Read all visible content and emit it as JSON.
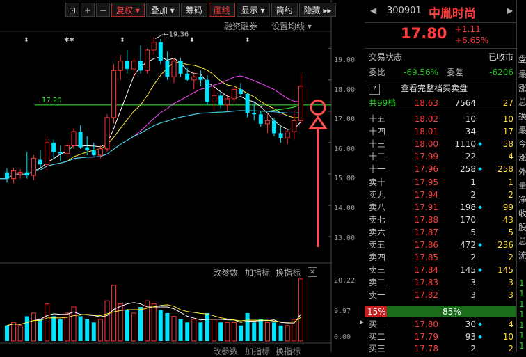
{
  "toolbar": {
    "items": [
      {
        "label": "复权 ▾",
        "active": true
      },
      {
        "label": "叠加 ▾",
        "active": false
      },
      {
        "label": "筹码",
        "active": false
      },
      {
        "label": "画线",
        "active": true
      },
      {
        "label": "显示 ▾",
        "active": false
      },
      {
        "label": "简约",
        "active": false
      },
      {
        "label": "隐藏 ▸▸",
        "active": false
      }
    ],
    "sub_financing": "融资融券",
    "sub_ma_setting": "设置均线 ▾"
  },
  "chart": {
    "price_axis": [
      "19.00",
      "18.00",
      "17.00",
      "16.00",
      "15.00",
      "14.00",
      "13.00"
    ],
    "vol_axis": [
      "20.22",
      "9.97",
      "0.00"
    ],
    "annot_high": "19.36",
    "annot_line": "17.20",
    "ind_buttons": [
      "改参数",
      "加指标",
      "换指标"
    ],
    "ind_close": "✕",
    "bot_buttons": [
      "改参数",
      "加指标",
      "换指标"
    ],
    "colors": {
      "up": "#ff3333",
      "down": "#00e5ff",
      "ma5": "#ffffff",
      "ma10": "#ffee33",
      "ma20": "#ff44ff",
      "ma60": "#33ff33",
      "ma120": "#44ccff",
      "annotation": "#ff4f4f"
    }
  },
  "chart_data": {
    "type": "candlestick",
    "candles": [
      {
        "o": 15.05,
        "h": 15.18,
        "l": 14.72,
        "c": 14.85,
        "v": 5
      },
      {
        "o": 14.85,
        "h": 15.2,
        "l": 14.7,
        "c": 15.1,
        "v": 6
      },
      {
        "o": 15.0,
        "h": 15.15,
        "l": 14.85,
        "c": 15.05,
        "v": 5
      },
      {
        "o": 15.05,
        "h": 15.7,
        "l": 14.85,
        "c": 14.95,
        "v": 8
      },
      {
        "o": 14.95,
        "h": 15.6,
        "l": 14.8,
        "c": 15.5,
        "v": 9
      },
      {
        "o": 15.45,
        "h": 15.75,
        "l": 15.2,
        "c": 15.3,
        "v": 7
      },
      {
        "o": 15.3,
        "h": 16.2,
        "l": 15.1,
        "c": 16.0,
        "v": 12
      },
      {
        "o": 16.0,
        "h": 16.1,
        "l": 15.5,
        "c": 15.7,
        "v": 8
      },
      {
        "o": 15.7,
        "h": 15.9,
        "l": 15.4,
        "c": 15.65,
        "v": 7
      },
      {
        "o": 15.65,
        "h": 16.0,
        "l": 15.5,
        "c": 15.9,
        "v": 9
      },
      {
        "o": 15.9,
        "h": 16.45,
        "l": 15.8,
        "c": 16.35,
        "v": 11
      },
      {
        "o": 16.35,
        "h": 16.55,
        "l": 15.8,
        "c": 15.85,
        "v": 8
      },
      {
        "o": 15.85,
        "h": 16.2,
        "l": 15.6,
        "c": 15.75,
        "v": 7
      },
      {
        "o": 15.75,
        "h": 16.0,
        "l": 15.55,
        "c": 15.6,
        "v": 6
      },
      {
        "o": 15.6,
        "h": 15.9,
        "l": 15.5,
        "c": 15.8,
        "v": 7
      },
      {
        "o": 15.8,
        "h": 16.9,
        "l": 15.7,
        "c": 16.8,
        "v": 13
      },
      {
        "o": 16.8,
        "h": 18.5,
        "l": 16.6,
        "c": 18.3,
        "v": 18
      },
      {
        "o": 18.3,
        "h": 18.8,
        "l": 18.0,
        "c": 18.6,
        "v": 12
      },
      {
        "o": 18.6,
        "h": 18.95,
        "l": 18.2,
        "c": 18.35,
        "v": 10
      },
      {
        "o": 18.35,
        "h": 18.7,
        "l": 18.1,
        "c": 18.6,
        "v": 9
      },
      {
        "o": 18.6,
        "h": 19.1,
        "l": 18.2,
        "c": 18.3,
        "v": 11
      },
      {
        "o": 18.3,
        "h": 19.0,
        "l": 18.2,
        "c": 18.95,
        "v": 13
      },
      {
        "o": 18.95,
        "h": 19.36,
        "l": 18.8,
        "c": 19.2,
        "v": 12
      },
      {
        "o": 19.2,
        "h": 19.3,
        "l": 18.5,
        "c": 18.6,
        "v": 10
      },
      {
        "o": 18.6,
        "h": 18.9,
        "l": 18.0,
        "c": 18.1,
        "v": 9
      },
      {
        "o": 18.1,
        "h": 18.7,
        "l": 17.9,
        "c": 18.6,
        "v": 8
      },
      {
        "o": 18.6,
        "h": 18.7,
        "l": 18.1,
        "c": 18.2,
        "v": 7
      },
      {
        "o": 18.2,
        "h": 18.4,
        "l": 17.95,
        "c": 18.0,
        "v": 6
      },
      {
        "o": 18.0,
        "h": 18.25,
        "l": 17.7,
        "c": 18.1,
        "v": 7
      },
      {
        "o": 18.1,
        "h": 18.3,
        "l": 17.8,
        "c": 18.0,
        "v": 6
      },
      {
        "o": 18.0,
        "h": 18.15,
        "l": 17.2,
        "c": 17.3,
        "v": 9
      },
      {
        "o": 17.3,
        "h": 17.8,
        "l": 17.0,
        "c": 17.5,
        "v": 7
      },
      {
        "o": 17.5,
        "h": 17.6,
        "l": 17.1,
        "c": 17.2,
        "v": 6
      },
      {
        "o": 17.2,
        "h": 17.5,
        "l": 17.0,
        "c": 17.4,
        "v": 6
      },
      {
        "o": 17.4,
        "h": 17.8,
        "l": 17.3,
        "c": 17.7,
        "v": 6
      },
      {
        "o": 17.7,
        "h": 17.9,
        "l": 17.5,
        "c": 17.55,
        "v": 5
      },
      {
        "o": 17.55,
        "h": 17.6,
        "l": 16.8,
        "c": 16.95,
        "v": 9
      },
      {
        "o": 16.95,
        "h": 17.3,
        "l": 16.7,
        "c": 16.9,
        "v": 6
      },
      {
        "o": 16.9,
        "h": 17.0,
        "l": 16.5,
        "c": 16.6,
        "v": 7
      },
      {
        "o": 16.6,
        "h": 16.9,
        "l": 16.3,
        "c": 16.7,
        "v": 6
      },
      {
        "o": 16.7,
        "h": 16.8,
        "l": 16.2,
        "c": 16.3,
        "v": 6
      },
      {
        "o": 16.3,
        "h": 16.5,
        "l": 16.0,
        "c": 16.15,
        "v": 5
      },
      {
        "o": 16.15,
        "h": 16.4,
        "l": 15.95,
        "c": 16.35,
        "v": 5
      },
      {
        "o": 16.35,
        "h": 17.0,
        "l": 16.1,
        "c": 16.7,
        "v": 7
      },
      {
        "o": 16.7,
        "h": 18.2,
        "l": 16.6,
        "c": 17.8,
        "v": 20
      }
    ],
    "ylim": [
      12.6,
      19.55
    ],
    "vol_ylim": [
      0,
      20.22
    ],
    "up_color": "#ff3333",
    "down_color": "#00e5ff"
  },
  "quote": {
    "code": "300901",
    "name": "中胤时尚",
    "price": "17.80",
    "change": "+1.11",
    "pct": "+6.65%",
    "trade_status_label": "交易状态",
    "trade_status_value": "已收市",
    "weibi_label": "委比",
    "weibi_value": "-69.56%",
    "weicha_label": "委差",
    "weicha_value": "-6206",
    "view_full": "查看完整档买卖盘",
    "total_label": "共99档",
    "total_price": "18.63",
    "total_vol": "7564",
    "total_count": "27",
    "sell": [
      {
        "label": "十五",
        "price": "18.02",
        "vol": "10",
        "cnt": "10",
        "dot": false
      },
      {
        "label": "十四",
        "price": "18.01",
        "vol": "34",
        "cnt": "17",
        "dot": false
      },
      {
        "label": "十三",
        "price": "18.00",
        "vol": "1110",
        "cnt": "58",
        "dot": true
      },
      {
        "label": "十二",
        "price": "17.99",
        "vol": "22",
        "cnt": "4",
        "dot": false
      },
      {
        "label": "十一",
        "price": "17.96",
        "vol": "258",
        "cnt": "258",
        "dot": true
      },
      {
        "label": "卖十",
        "price": "17.95",
        "vol": "1",
        "cnt": "1",
        "dot": false
      },
      {
        "label": "卖九",
        "price": "17.94",
        "vol": "2",
        "cnt": "2",
        "dot": false
      },
      {
        "label": "卖八",
        "price": "17.91",
        "vol": "198",
        "cnt": "99",
        "dot": true
      },
      {
        "label": "卖七",
        "price": "17.88",
        "vol": "170",
        "cnt": "43",
        "dot": false
      },
      {
        "label": "卖六",
        "price": "17.87",
        "vol": "5",
        "cnt": "5",
        "dot": false
      },
      {
        "label": "卖五",
        "price": "17.86",
        "vol": "472",
        "cnt": "236",
        "dot": true
      },
      {
        "label": "卖四",
        "price": "17.85",
        "vol": "2",
        "cnt": "2",
        "dot": false
      },
      {
        "label": "卖三",
        "price": "17.84",
        "vol": "145",
        "cnt": "145",
        "dot": true
      },
      {
        "label": "卖二",
        "price": "17.83",
        "vol": "3",
        "cnt": "3",
        "dot": false
      },
      {
        "label": "卖一",
        "price": "17.82",
        "vol": "3",
        "cnt": "3",
        "dot": false
      }
    ],
    "ratio_left": "15%",
    "ratio_right": "85%",
    "buy": [
      {
        "label": "买一",
        "price": "17.80",
        "vol": "30",
        "cnt": "4",
        "dot": true
      },
      {
        "label": "买二",
        "price": "17.79",
        "vol": "93",
        "cnt": "10",
        "dot": true
      },
      {
        "label": "买三",
        "price": "17.78",
        "vol": "2",
        "cnt": "2",
        "dot": false
      }
    ]
  },
  "strip": {
    "top": "盘",
    "labels": [
      "最",
      "涨",
      "总",
      "换",
      "最",
      "今",
      "涨",
      "外",
      "量",
      "净",
      "收",
      "股",
      "总",
      "流"
    ],
    "bottom": [
      "1",
      "1",
      "1",
      "1",
      "1",
      "1",
      "1"
    ]
  }
}
